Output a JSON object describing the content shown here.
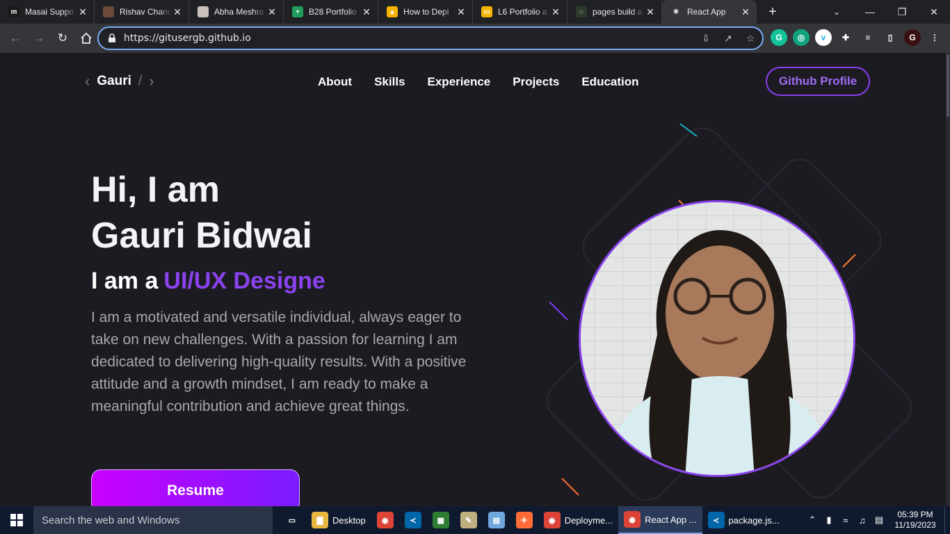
{
  "browser": {
    "tabs": [
      {
        "label": "Masai Suppo",
        "icon": "masai-icon",
        "color": "#1a1a1a",
        "glyph": "m"
      },
      {
        "label": "Rishav Chand",
        "icon": "user-avatar-icon",
        "color": "#6b4a3a",
        "glyph": ""
      },
      {
        "label": "Abha Meshra",
        "icon": "user-avatar-icon",
        "color": "#c9c2bb",
        "glyph": ""
      },
      {
        "label": "B28 Portfolio",
        "icon": "google-sheets-icon",
        "color": "#1e9e5a",
        "glyph": "+"
      },
      {
        "label": "How to Depl",
        "icon": "google-drive-icon",
        "color": "#f4b400",
        "glyph": "▲"
      },
      {
        "label": "L6 Portfolio a",
        "icon": "google-slides-icon",
        "color": "#f4b400",
        "glyph": "▭"
      },
      {
        "label": "pages build a",
        "icon": "github-loading-icon",
        "color": "#2d3b2d",
        "glyph": "◌"
      },
      {
        "label": "React App",
        "icon": "react-icon",
        "color": "#35363a",
        "glyph": "⚛",
        "active": true
      }
    ],
    "url": "https://gitusergb.github.io",
    "extensions": [
      {
        "icon": "grammarly-icon",
        "color": "#15c39a",
        "glyph": "G"
      },
      {
        "icon": "chat-extension-icon",
        "color": "#10a37f",
        "glyph": "◎"
      },
      {
        "icon": "vimeo-icon",
        "color": "#ffffff",
        "glyph": "v"
      },
      {
        "icon": "puzzle-icon",
        "color": "#35363a",
        "glyph": "✚"
      },
      {
        "icon": "media-control-icon",
        "color": "#35363a",
        "glyph": "≡"
      },
      {
        "icon": "side-panel-icon",
        "color": "#35363a",
        "glyph": "▯"
      },
      {
        "icon": "profile-avatar-icon",
        "color": "#3a1010",
        "glyph": "G"
      },
      {
        "icon": "kebab-menu-icon",
        "color": "#35363a",
        "glyph": "⋮"
      }
    ]
  },
  "site": {
    "logo": {
      "name": "Gauri",
      "slash": "/"
    },
    "nav": [
      "About",
      "Skills",
      "Experience",
      "Projects",
      "Education"
    ],
    "github_button": "Github Profile",
    "hero": {
      "greeting": "Hi, I am",
      "name": "Gauri Bidwai",
      "tag_prefix": "I am a",
      "role": "UI/UX Designe",
      "description": "I am a motivated and versatile individual, always eager to take on new challenges. With a passion for learning I am dedicated to delivering high-quality results. With a positive attitude and a growth mindset, I am ready to make a meaningful contribution and achieve great things.",
      "resume_button": "Resume"
    },
    "accent": "#8a43ee"
  },
  "taskbar": {
    "search_placeholder": "Search the web and Windows",
    "items": [
      {
        "label": "",
        "icon": "task-view-icon",
        "color": "transparent",
        "glyph": "▭"
      },
      {
        "label": "Desktop",
        "icon": "folder-icon",
        "color": "#e8b740",
        "glyph": "▇"
      },
      {
        "label": "",
        "icon": "chrome-icon",
        "color": "#db4437",
        "glyph": "◉"
      },
      {
        "label": "",
        "icon": "vscode-icon",
        "color": "#0065a9",
        "glyph": "≺"
      },
      {
        "label": "",
        "icon": "spreadsheet-icon",
        "color": "#2e7d32",
        "glyph": "▦"
      },
      {
        "label": "",
        "icon": "paint-icon",
        "color": "#c0b080",
        "glyph": "✎"
      },
      {
        "label": "",
        "icon": "notepad-icon",
        "color": "#6fa8dc",
        "glyph": "▤"
      },
      {
        "label": "",
        "icon": "postman-icon",
        "color": "#ff6c37",
        "glyph": "✈"
      },
      {
        "label": "Deployme...",
        "icon": "chrome-profile-icon",
        "color": "#db4437",
        "glyph": "◉"
      },
      {
        "label": "React App ...",
        "icon": "chrome-profile-icon",
        "color": "#db4437",
        "glyph": "◉",
        "active": true
      },
      {
        "label": "package.js...",
        "icon": "vscode-icon",
        "color": "#0065a9",
        "glyph": "≺"
      }
    ],
    "time": "05:39 PM",
    "date": "11/19/2023"
  }
}
